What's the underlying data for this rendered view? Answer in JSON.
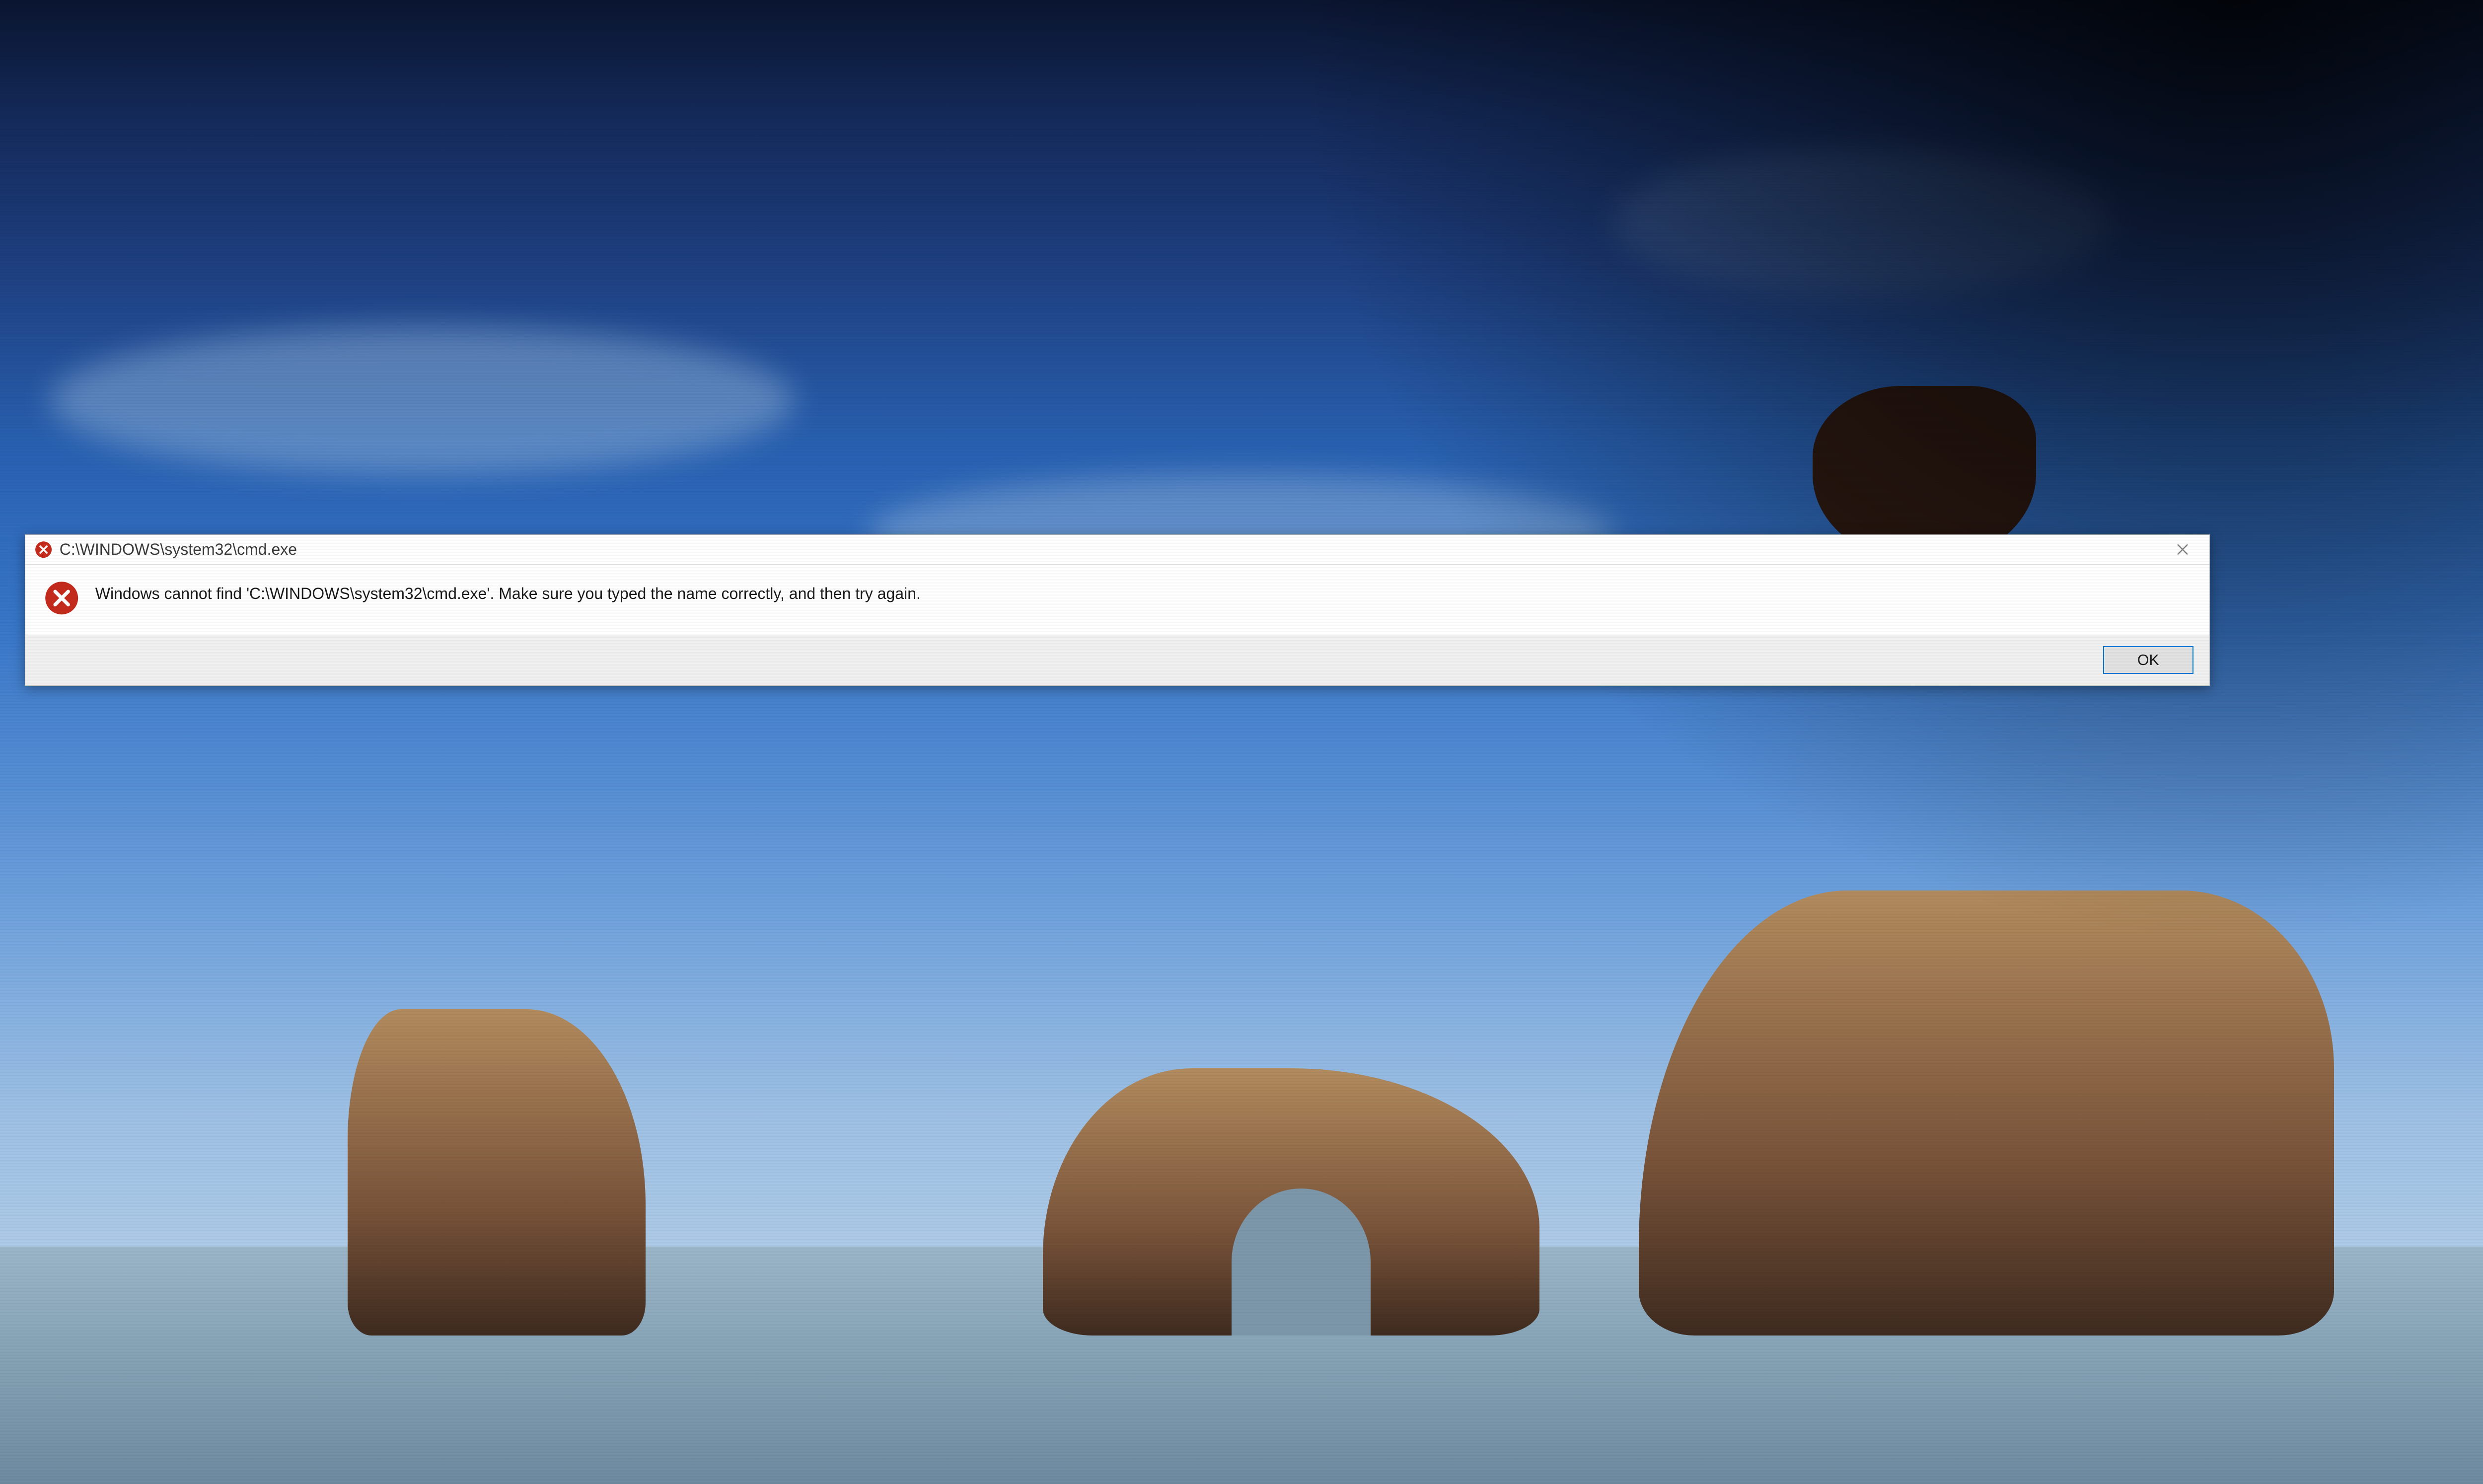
{
  "dialog": {
    "title": "C:\\WINDOWS\\system32\\cmd.exe",
    "message": "Windows cannot find 'C:\\WINDOWS\\system32\\cmd.exe'. Make sure you typed the name correctly, and then try again.",
    "ok_label": "OK",
    "icon_name": "error-x",
    "colors": {
      "error_red": "#c42b1c",
      "accent_blue": "#0078d7"
    }
  }
}
